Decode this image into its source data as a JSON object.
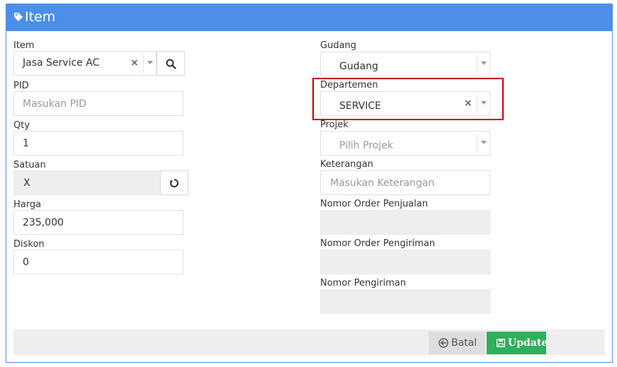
{
  "header": {
    "title": "Item",
    "icon": "tag-icon",
    "color": "#4b8fea"
  },
  "left": {
    "item": {
      "label": "Item",
      "value": "Jasa Service AC",
      "clear": "×"
    },
    "pid": {
      "label": "PID",
      "placeholder": "Masukan PID"
    },
    "qty": {
      "label": "Qty",
      "value": "1"
    },
    "satuan": {
      "label": "Satuan",
      "value": "X"
    },
    "harga": {
      "label": "Harga",
      "value": "235,000"
    },
    "diskon": {
      "label": "Diskon",
      "value": "0"
    }
  },
  "right": {
    "gudang": {
      "label": "Gudang",
      "value": "Gudang"
    },
    "departemen": {
      "label": "Departemen",
      "value": "SERVICE",
      "clear": "×"
    },
    "projek": {
      "label": "Projek",
      "placeholder": "Pilih Projek"
    },
    "keterangan": {
      "label": "Keterangan",
      "placeholder": "Masukan Keterangan"
    },
    "nomor_order_penjualan": {
      "label": "Nomor Order Penjualan",
      "value": ""
    },
    "nomor_order_pengiriman": {
      "label": "Nomor Order Pengiriman",
      "value": ""
    },
    "nomor_pengiriman": {
      "label": "Nomor Pengiriman",
      "value": ""
    }
  },
  "footer": {
    "batal_label": "Batal",
    "update_label": "Update",
    "update_color": "#2db05a"
  },
  "highlight_color": "#c90000"
}
